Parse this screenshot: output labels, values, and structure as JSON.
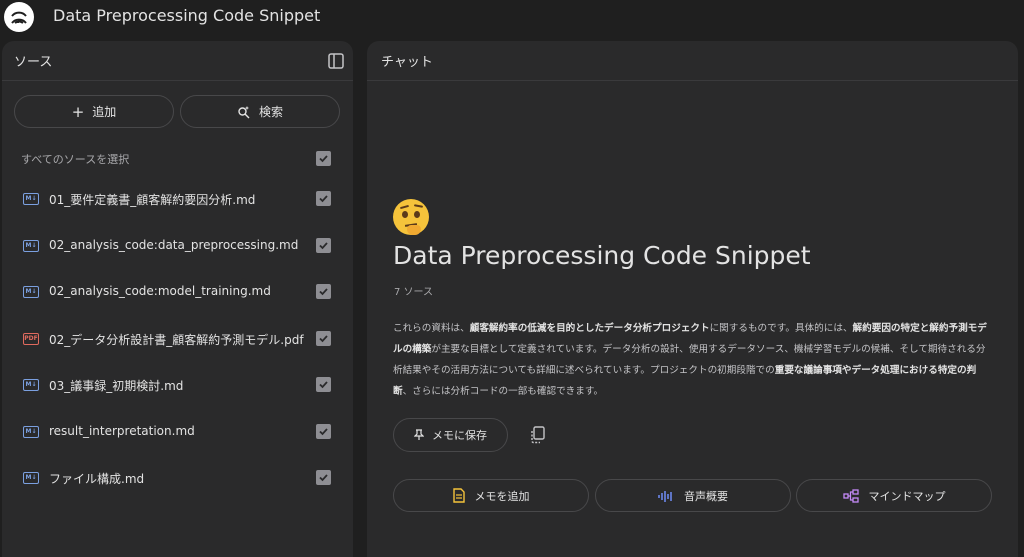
{
  "app": {
    "title": "Data Preprocessing Code Snippet"
  },
  "sources_panel": {
    "title": "ソース",
    "add_label": "追加",
    "search_label": "検索",
    "select_all_label": "すべてのソースを選択",
    "items": [
      {
        "label": "01_要件定義書_顧客解約要因分析.md",
        "type": "md",
        "checked": true
      },
      {
        "label": "02_analysis_code:data_preprocessing.md",
        "type": "md",
        "checked": true
      },
      {
        "label": "02_analysis_code:model_training.md",
        "type": "md",
        "checked": true
      },
      {
        "label": "02_データ分析設計書_顧客解約予測モデル.pdf",
        "type": "pdf",
        "checked": true
      },
      {
        "label": "03_議事録_初期検討.md",
        "type": "md",
        "checked": true
      },
      {
        "label": "result_interpretation.md",
        "type": "md",
        "checked": true
      },
      {
        "label": "ファイル構成.md",
        "type": "md",
        "checked": true
      }
    ]
  },
  "chat_panel": {
    "title": "チャット",
    "notebook_title": "Data Preprocessing Code Snippet",
    "source_count": "7 ソース",
    "summary_parts": [
      {
        "text": "これらの資料は、",
        "bold": false
      },
      {
        "text": "顧客解約率の低減を目的としたデータ分析プロジェクト",
        "bold": true
      },
      {
        "text": "に関するものです。具体的には、",
        "bold": false
      },
      {
        "text": "解約要因の特定と解約予測モデルの構築",
        "bold": true
      },
      {
        "text": "が主要な目標として定義されています。データ分析の設計、使用するデータソース、機械学習モデルの候補、そして期待される分析結果やその活用方法についても詳細に述べられています。プロジェクトの初期段階での",
        "bold": false
      },
      {
        "text": "重要な議論事項やデータ処理における特定の判断",
        "bold": true
      },
      {
        "text": "、さらには分析コードの一部も確認できます。",
        "bold": false
      }
    ],
    "save_note_label": "メモに保存",
    "actions": [
      {
        "label": "メモを追加",
        "icon": "note-icon"
      },
      {
        "label": "音声概要",
        "icon": "audio-wave-icon"
      },
      {
        "label": "マインドマップ",
        "icon": "mindmap-icon"
      }
    ]
  },
  "colors": {
    "background": "#1f1f1f",
    "panel": "#2a2a2b",
    "checkbox": "#8e8e93",
    "md_icon": "#7ba0e0",
    "pdf_icon": "#e06a5e",
    "note_icon": "#f5c33b",
    "audio_icon": "#6f8df7",
    "mindmap_icon": "#c58af9"
  }
}
